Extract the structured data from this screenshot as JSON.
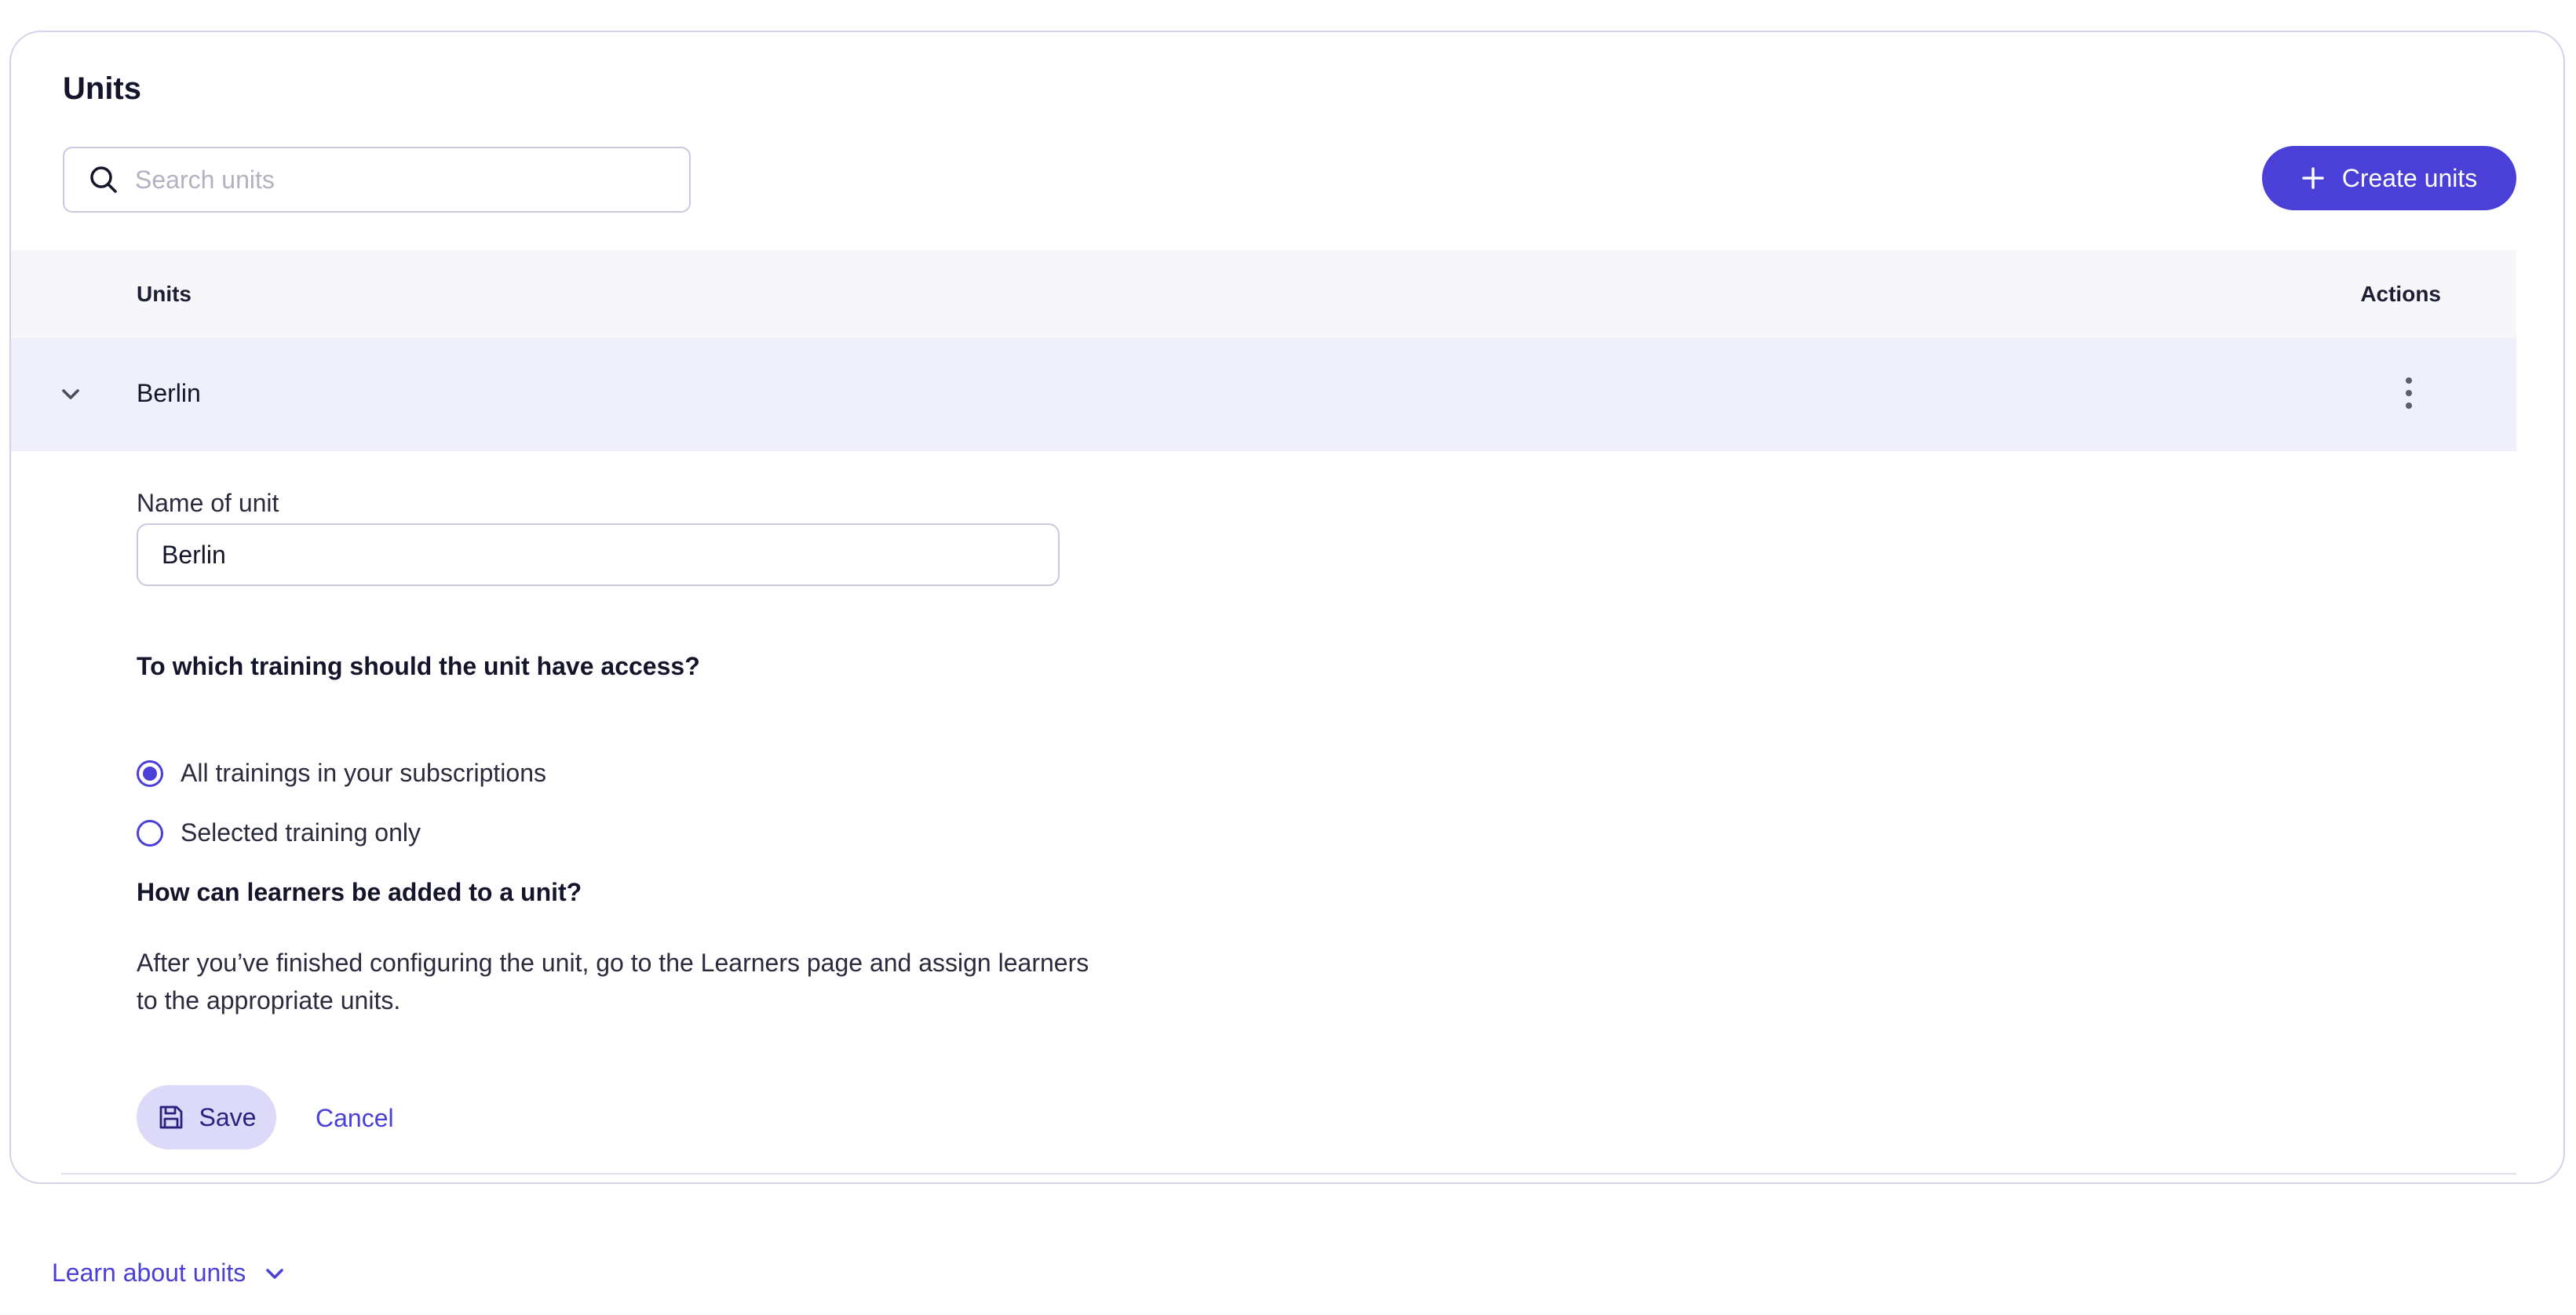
{
  "card": {
    "title": "Units"
  },
  "search": {
    "placeholder": "Search units",
    "value": ""
  },
  "create_button": {
    "label": "Create units"
  },
  "table": {
    "columns": {
      "units": "Units",
      "actions": "Actions"
    },
    "rows": [
      {
        "label": "Berlin",
        "expanded": true
      }
    ]
  },
  "editor": {
    "name_label": "Name of unit",
    "name_value": "Berlin",
    "access_question": "To which training should the unit have access?",
    "options": [
      {
        "label": "All trainings in your subscriptions",
        "selected": true
      },
      {
        "label": "Selected training only",
        "selected": false
      }
    ],
    "learners_question": "How can learners be added to a unit?",
    "learners_help": "After you’ve finished configuring the unit, go to the Learners page and assign learners to the appropriate units.",
    "save_label": "Save",
    "cancel_label": "Cancel"
  },
  "footer": {
    "learn_label": "Learn about units"
  },
  "colors": {
    "accent": "#4a3fd7",
    "row_highlight": "#f0f0fd",
    "save_bg": "#dcdaf8"
  },
  "icons": {
    "search": "search-icon",
    "plus": "plus-icon",
    "chevron": "chevron-down-icon",
    "kebab": "kebab-menu-icon",
    "save": "floppy-disk-icon"
  }
}
